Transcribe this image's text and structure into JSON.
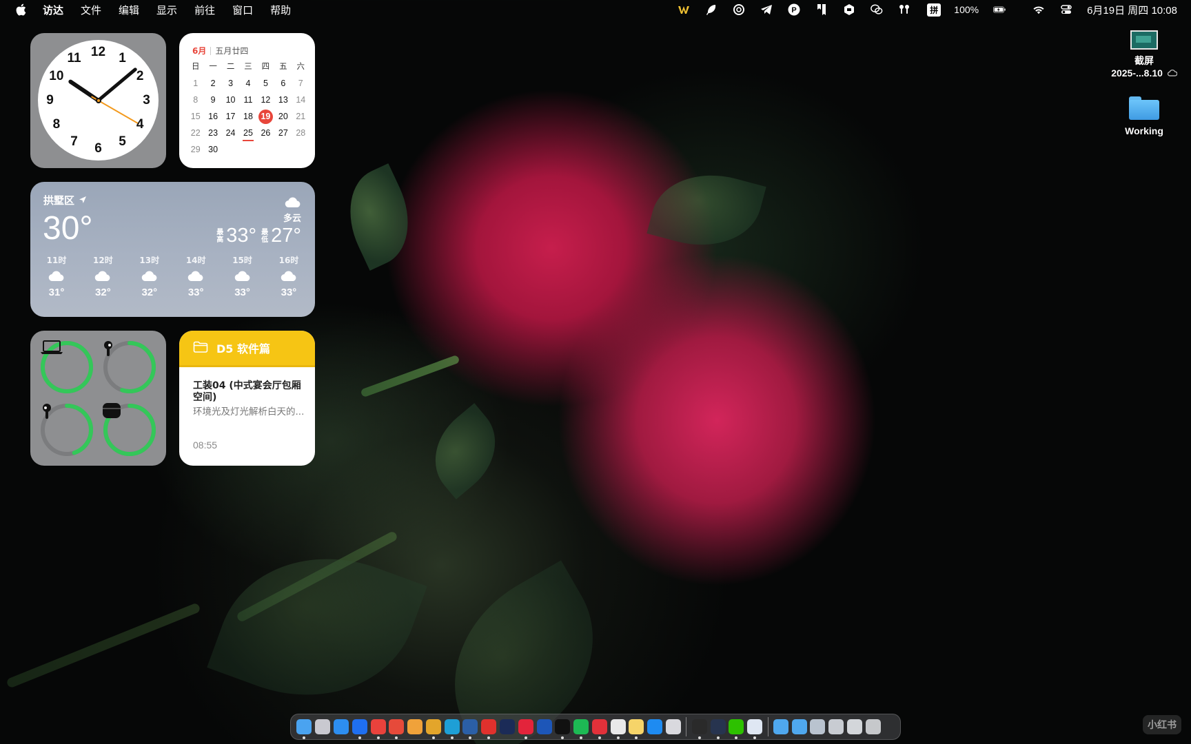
{
  "menubar": {
    "apple_icon": "apple-logo-icon",
    "menus": [
      "访达",
      "文件",
      "编辑",
      "显示",
      "前往",
      "窗口",
      "帮助"
    ],
    "status_icons": [
      "wps-icon",
      "feather-icon",
      "chatgpt-icon",
      "telegram-icon",
      "p-icon",
      "bookmark-app-icon",
      "cube-app-icon",
      "wechat-icon",
      "airpods-icon"
    ],
    "input_method": "拼",
    "battery_percent": "100%",
    "battery_level": 1.0,
    "wifi_icon": "wifi-icon",
    "control_center_icon": "control-center-icon",
    "datetime": "6月19日 周四  10:08"
  },
  "clock_widget": {
    "numbers": [
      "12",
      "1",
      "2",
      "3",
      "4",
      "5",
      "6",
      "7",
      "8",
      "9",
      "10",
      "11"
    ],
    "time": {
      "hour": 10,
      "minute": 8,
      "second": 20
    }
  },
  "calendar_widget": {
    "month": "6月",
    "lunar": "五月廿四",
    "weekdays": [
      "日",
      "一",
      "二",
      "三",
      "四",
      "五",
      "六"
    ],
    "days": [
      "1",
      "2",
      "3",
      "4",
      "5",
      "6",
      "7",
      "8",
      "9",
      "10",
      "11",
      "12",
      "13",
      "14",
      "15",
      "16",
      "17",
      "18",
      "19",
      "20",
      "21",
      "22",
      "23",
      "24",
      "25",
      "26",
      "27",
      "28",
      "29",
      "30"
    ],
    "today": "19",
    "underlined": "25"
  },
  "weather_widget": {
    "location": "拱墅区",
    "temperature": "30°",
    "condition": "多云",
    "high_label": "最高",
    "high": "33°",
    "low_label": "最低",
    "low": "27°",
    "hourly": [
      {
        "time": "11时",
        "temp": "31°",
        "icon": "cloud-icon"
      },
      {
        "time": "12时",
        "temp": "32°",
        "icon": "cloud-icon"
      },
      {
        "time": "13时",
        "temp": "32°",
        "icon": "cloud-icon"
      },
      {
        "time": "14时",
        "temp": "33°",
        "icon": "cloud-icon"
      },
      {
        "time": "15时",
        "temp": "33°",
        "icon": "cloud-icon"
      },
      {
        "time": "16时",
        "temp": "33°",
        "icon": "cloud-icon"
      }
    ]
  },
  "battery_widget": {
    "devices": [
      {
        "name": "laptop-icon",
        "level": 1.0
      },
      {
        "name": "airpod-right-icon",
        "level": 0.55
      },
      {
        "name": "airpod-left-icon",
        "level": 0.45
      },
      {
        "name": "airpods-case-icon",
        "level": 0.85
      }
    ],
    "ring_color": "#34c759"
  },
  "notes_widget": {
    "folder": "D5 软件篇",
    "title": "工装04 (中式宴会厅包厢空间)",
    "body": "环境光及灯光解析白天的...",
    "time": "08:55"
  },
  "desktop_icons": [
    {
      "label_line1": "截屏",
      "label_line2": "2025-...8.10",
      "icon": "screenshot-thumbnail"
    },
    {
      "label_line1": "Working",
      "icon": "folder-icon"
    }
  ],
  "dock": {
    "apps": [
      {
        "name": "finder-icon",
        "color": "#4aa3f0",
        "running": true
      },
      {
        "name": "launchpad-icon",
        "color": "#c9c9d0",
        "running": false
      },
      {
        "name": "safari-icon",
        "color": "#2d8ef0",
        "running": false
      },
      {
        "name": "baidu-netdisk-icon",
        "color": "#1f6ff0",
        "running": true
      },
      {
        "name": "wps-icon",
        "color": "#e9423c",
        "running": true
      },
      {
        "name": "xmind-icon",
        "color": "#e64a3a",
        "running": true
      },
      {
        "name": "photos-icon",
        "color": "#f0a23a",
        "running": false
      },
      {
        "name": "chrome-icon",
        "color": "#e3a52b",
        "running": true
      },
      {
        "name": "edge-icon",
        "color": "#1e9fd6",
        "running": true
      },
      {
        "name": "openai-icon",
        "color": "#2b5fa6",
        "running": true
      },
      {
        "name": "acrobat-icon",
        "color": "#e0312d",
        "running": true
      },
      {
        "name": "photoshop-icon",
        "color": "#1b2b57",
        "running": false
      },
      {
        "name": "pinterest-icon",
        "color": "#e3243b",
        "running": true
      },
      {
        "name": "cnki-icon",
        "color": "#1d56b8",
        "running": false
      },
      {
        "name": "tiktok-icon",
        "color": "#111111",
        "running": true
      },
      {
        "name": "spotify-icon",
        "color": "#1db954",
        "running": true
      },
      {
        "name": "netease-music-icon",
        "color": "#e2313a",
        "running": true
      },
      {
        "name": "chatgpt-icon",
        "color": "#e9e9e9",
        "running": true
      },
      {
        "name": "notes-icon",
        "color": "#f6d469",
        "running": true
      },
      {
        "name": "app-store-icon",
        "color": "#1e8bf1",
        "running": false
      },
      {
        "name": "preview-icon",
        "color": "#d9d9de",
        "running": false
      },
      {
        "name": "activity-monitor-icon",
        "color": "#2a2a2a",
        "running": true
      },
      {
        "name": "cube-app-icon",
        "color": "#27344f",
        "running": true
      },
      {
        "name": "wechat-icon",
        "color": "#2dc100",
        "running": true
      },
      {
        "name": "baidu-cloud-icon",
        "color": "#dfe7f3",
        "running": true
      },
      {
        "name": "downloads-folder-icon",
        "color": "#4fa8ee",
        "running": false
      },
      {
        "name": "documents-folder-icon",
        "color": "#4fa8ee",
        "running": false
      },
      {
        "name": "window-stack-icon",
        "color": "#b9c3cf",
        "running": false
      },
      {
        "name": "screenshot-stack-icon",
        "color": "#c8ccd2",
        "running": false
      },
      {
        "name": "keyboard-stack-icon",
        "color": "#d3d6da",
        "running": false
      },
      {
        "name": "trash-icon",
        "color": "#c6c8cb",
        "running": false
      }
    ],
    "separator_after": [
      20,
      24
    ]
  },
  "watermark": "小红书"
}
